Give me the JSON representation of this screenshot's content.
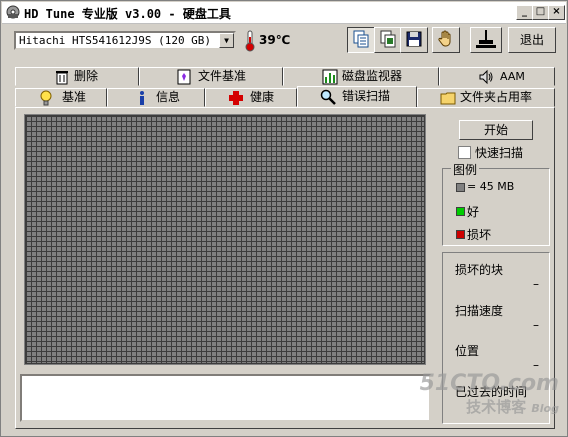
{
  "window": {
    "title": "HD Tune 专业版 v3.00 - 硬盘工具",
    "min_label": "_",
    "max_label": "□",
    "close_label": "×"
  },
  "toolbar": {
    "drive": "Hitachi HTS541612J9S (120 GB)",
    "temperature": "39℃",
    "exit_label": "退出"
  },
  "tabs_row1": [
    {
      "label": "删除",
      "icon": "trash-icon"
    },
    {
      "label": "文件基准",
      "icon": "file-benchmark-icon"
    },
    {
      "label": "磁盘监视器",
      "icon": "monitor-chart-icon"
    },
    {
      "label": "AAM",
      "icon": "speaker-icon"
    }
  ],
  "tabs_row2": [
    {
      "label": "基准",
      "icon": "bulb-icon"
    },
    {
      "label": "信息",
      "icon": "info-icon"
    },
    {
      "label": "健康",
      "icon": "red-cross-icon"
    },
    {
      "label": "错误扫描",
      "icon": "magnifier-icon",
      "active": true
    },
    {
      "label": "文件夹占用率",
      "icon": "folder-icon"
    }
  ],
  "scan": {
    "start_label": "开始",
    "quick_scan_label": "快速扫描",
    "quick_scan_checked": false
  },
  "legend": {
    "title": "图例",
    "block_size": "= 45 MB",
    "good_label": "好",
    "damaged_label": "损坏",
    "colors": {
      "block": "#808080",
      "good": "#00cc00",
      "damaged": "#cc0000"
    }
  },
  "stats": {
    "damaged_blocks_label": "损坏的块",
    "damaged_blocks_value": "–",
    "scan_speed_label": "扫描速度",
    "scan_speed_value": "–",
    "position_label": "位置",
    "position_value": "–",
    "elapsed_label": "已过去的时间"
  },
  "watermark": {
    "site": "51CTO.com",
    "sub": "技术博客",
    "blog": "Blog"
  }
}
